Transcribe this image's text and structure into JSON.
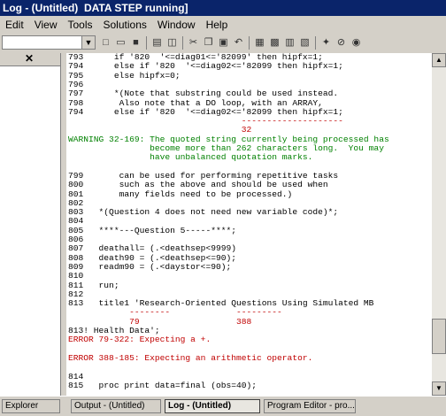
{
  "window": {
    "title": "Log - (Untitled)  DATA STEP running]"
  },
  "menu": [
    "Edit",
    "View",
    "Tools",
    "Solutions",
    "Window",
    "Help"
  ],
  "toolbar": {
    "command_value": ""
  },
  "log_lines": [
    {
      "text": "793      if '820  '<=diag01<='82099' then hipfx=1;",
      "cls": "blk"
    },
    {
      "text": "794      else if '820  '<=diag02<='82099 then hipfx=1;",
      "cls": "blk"
    },
    {
      "text": "795      else hipfx=0;",
      "cls": "blk"
    },
    {
      "text": "796",
      "cls": "blk"
    },
    {
      "text": "797      *(Note that substring could be used instead.",
      "cls": "blk"
    },
    {
      "text": "798       Also note that a DO loop, with an ARRAY,",
      "cls": "blk"
    },
    {
      "text": "794      else if '820  '<=diag02<='82099 then hipfx=1;",
      "cls": "blk"
    },
    {
      "text": "                                  --------------------",
      "cls": "red"
    },
    {
      "text": "                                  32",
      "cls": "red"
    },
    {
      "text": "WARNING 32-169: The quoted string currently being processed has",
      "cls": "grn"
    },
    {
      "text": "                become more than 262 characters long.  You may",
      "cls": "grn"
    },
    {
      "text": "                have unbalanced quotation marks.",
      "cls": "grn"
    },
    {
      "text": "",
      "cls": "blk"
    },
    {
      "text": "799       can be used for performing repetitive tasks",
      "cls": "blk"
    },
    {
      "text": "800       such as the above and should be used when",
      "cls": "blk"
    },
    {
      "text": "801       many fields need to be processed.)",
      "cls": "blk"
    },
    {
      "text": "802",
      "cls": "blk"
    },
    {
      "text": "803   *(Question 4 does not need new variable code)*;",
      "cls": "blk"
    },
    {
      "text": "804",
      "cls": "blk"
    },
    {
      "text": "805   ****---Question 5-----****;",
      "cls": "blk"
    },
    {
      "text": "806",
      "cls": "blk"
    },
    {
      "text": "807   deathall= (.<deathsep<9999)",
      "cls": "blk"
    },
    {
      "text": "808   death90 = (.<deathsep<=90);",
      "cls": "blk"
    },
    {
      "text": "809   readm90 = (.<daystor<=90);",
      "cls": "blk"
    },
    {
      "text": "810",
      "cls": "blk"
    },
    {
      "text": "811   run;",
      "cls": "blk"
    },
    {
      "text": "812",
      "cls": "blk"
    },
    {
      "text": "813   title1 'Research-Oriented Questions Using Simulated MB",
      "cls": "blk"
    },
    {
      "text": "            --------             ---------",
      "cls": "red"
    },
    {
      "text": "            79                   388",
      "cls": "red"
    },
    {
      "text": "813! Health Data';",
      "cls": "blk"
    },
    {
      "text": "ERROR 79-322: Expecting a +.",
      "cls": "red"
    },
    {
      "text": "",
      "cls": "blk"
    },
    {
      "text": "ERROR 388-185: Expecting an arithmetic operator.",
      "cls": "red"
    },
    {
      "text": "",
      "cls": "blk"
    },
    {
      "text": "814",
      "cls": "blk"
    },
    {
      "text": "815   proc print data=final (obs=40);",
      "cls": "blk"
    }
  ],
  "taskbar": {
    "explorer": "Explorer",
    "output": "Output - (Untitled)",
    "log": "Log - (Untitled)",
    "program_editor": "Program Editor - pro..."
  }
}
